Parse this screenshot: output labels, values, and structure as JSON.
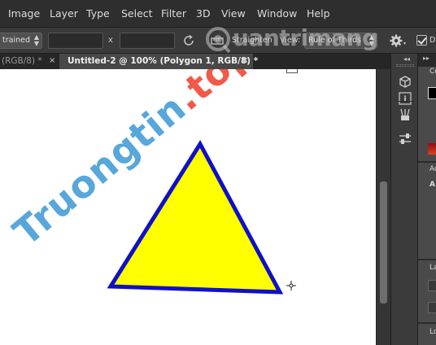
{
  "menu": {
    "items": [
      "Image",
      "Layer",
      "Type",
      "Select",
      "Filter",
      "3D",
      "View",
      "Window",
      "Help"
    ]
  },
  "options": {
    "constraint_label": "trained",
    "x_sep": "x",
    "straighten_label": "Straighten",
    "view_label": "View:",
    "overlay_label": "Rule of Thirds",
    "delete_cropped_label": "D"
  },
  "tabs": [
    {
      "label": "(RGB/8) *",
      "active": false
    },
    {
      "label": "Untitled-2 @ 100% (Polygon 1, RGB/8) *",
      "active": true
    }
  ],
  "tab_close_glyph": "×",
  "canvas": {
    "shape": "triangle",
    "fill": "#ffff00",
    "stroke": "#1010c8",
    "watermark_main": "Truongtin",
    "watermark_dot": ".",
    "watermark_tld": "top"
  },
  "logo": {
    "text": "uantrimang"
  },
  "right_panel": {
    "labels": [
      "Co",
      "Ad",
      "A",
      "La",
      "Lo"
    ]
  }
}
